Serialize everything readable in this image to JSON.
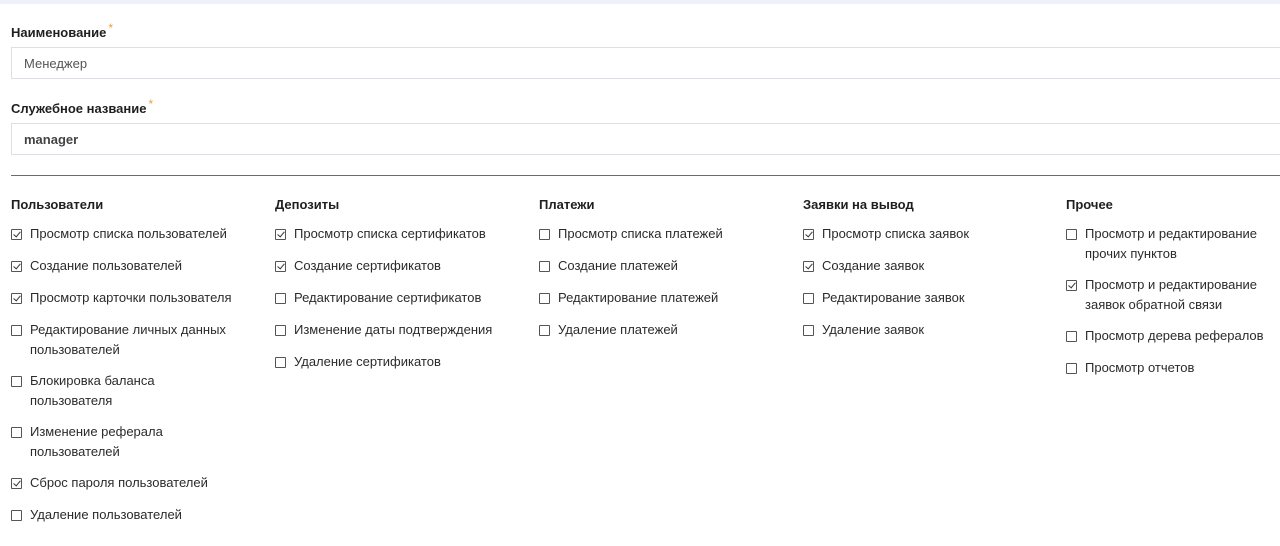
{
  "form": {
    "name_label": "Наименование",
    "name_required": "*",
    "name_value": "Менеджер",
    "service_label": "Служебное название",
    "service_required": "*",
    "service_value": "manager"
  },
  "columns": [
    {
      "title": "Пользователи",
      "items": [
        {
          "label": "Просмотр списка пользователей",
          "checked": true
        },
        {
          "label": "Создание пользователей",
          "checked": true
        },
        {
          "label": "Просмотр карточки пользователя",
          "checked": true
        },
        {
          "label": "Редактирование личных данных\nпользователей",
          "checked": false
        },
        {
          "label": "Блокировка баланса\nпользователя",
          "checked": false
        },
        {
          "label": "Изменение реферала\nпользователей",
          "checked": false
        },
        {
          "label": "Сброс пароля пользователей",
          "checked": true
        },
        {
          "label": "Удаление пользователей",
          "checked": false
        }
      ]
    },
    {
      "title": "Депозиты",
      "items": [
        {
          "label": "Просмотр списка сертификатов",
          "checked": true
        },
        {
          "label": "Создание сертификатов",
          "checked": true
        },
        {
          "label": "Редактирование сертификатов",
          "checked": false
        },
        {
          "label": "Изменение даты подтверждения",
          "checked": false
        },
        {
          "label": "Удаление сертификатов",
          "checked": false
        }
      ]
    },
    {
      "title": "Платежи",
      "items": [
        {
          "label": "Просмотр списка платежей",
          "checked": false
        },
        {
          "label": "Создание платежей",
          "checked": false
        },
        {
          "label": "Редактирование платежей",
          "checked": false
        },
        {
          "label": "Удаление платежей",
          "checked": false
        }
      ]
    },
    {
      "title": "Заявки на вывод",
      "items": [
        {
          "label": "Просмотр списка заявок",
          "checked": true
        },
        {
          "label": "Создание заявок",
          "checked": true
        },
        {
          "label": "Редактирование заявок",
          "checked": false
        },
        {
          "label": "Удаление заявок",
          "checked": false
        }
      ]
    },
    {
      "title": "Прочее",
      "items": [
        {
          "label": "Просмотр и редактирование\nпрочих пунктов",
          "checked": false
        },
        {
          "label": "Просмотр и редактирование\nзаявок обратной связи",
          "checked": true
        },
        {
          "label": "Просмотр дерева рефералов",
          "checked": false
        },
        {
          "label": "Просмотр отчетов",
          "checked": false
        }
      ]
    }
  ]
}
